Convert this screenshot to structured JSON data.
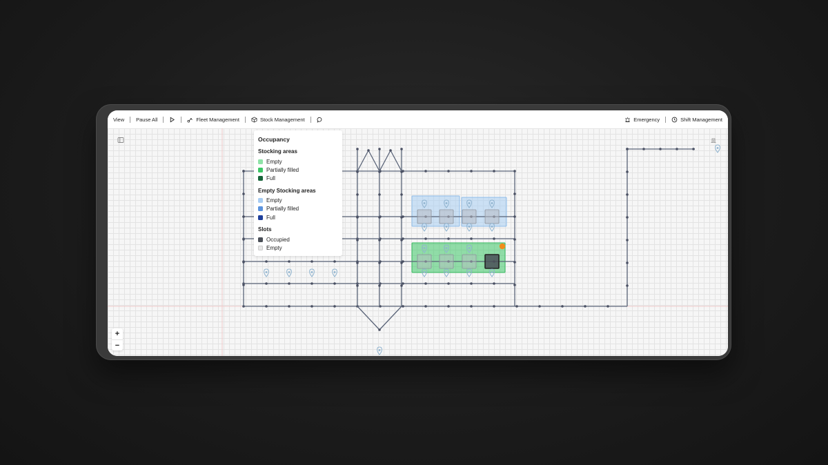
{
  "toolbar": {
    "view_label": "View",
    "pause_all_label": "Pause All",
    "play_icon": "play-icon",
    "fleet_label": "Fleet Management",
    "fleet_icon": "robot-arm-icon",
    "stock_label": "Stock Management",
    "stock_icon": "box-icon",
    "chat_icon": "chat-icon",
    "emergency_label": "Emergency",
    "emergency_icon": "siren-icon",
    "shift_label": "Shift Management",
    "shift_icon": "clock-icon"
  },
  "legend": {
    "title": "Occupancy",
    "stocking_areas": {
      "heading": "Stocking areas",
      "items": [
        {
          "label": "Empty",
          "color": "#8fe3a8"
        },
        {
          "label": "Partially filled",
          "color": "#3cc766"
        },
        {
          "label": "Full",
          "color": "#17643a"
        }
      ]
    },
    "empty_stocking_areas": {
      "heading": "Empty Stocking areas",
      "items": [
        {
          "label": "Empty",
          "color": "#a8cdf3"
        },
        {
          "label": "Partially filled",
          "color": "#5b93de"
        },
        {
          "label": "Full",
          "color": "#1f3f9b"
        }
      ]
    },
    "slots": {
      "heading": "Slots",
      "items": [
        {
          "label": "Occupied",
          "color": "#4a4f57"
        },
        {
          "label": "Empty",
          "color": "#e8e8e8"
        }
      ]
    }
  },
  "zoom": {
    "in_label": "+",
    "out_label": "−"
  },
  "colors": {
    "path": "#5a6478",
    "node": "#4a5063",
    "stock_green": "#3cc766",
    "empty_blue": "#a8cdf3",
    "alert": "#f08c1a"
  }
}
